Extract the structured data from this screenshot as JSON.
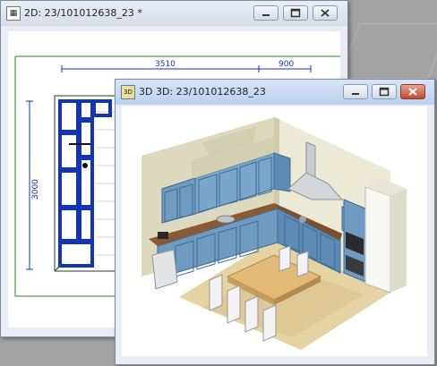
{
  "windows": {
    "win2d": {
      "title": "2D: 23/101012638_23 *",
      "dimensions": {
        "top_left": "3510",
        "top_right": "900",
        "side": "3000"
      }
    },
    "win3d": {
      "title": "3D 3D: 23/101012638_23",
      "icon": "3D"
    }
  },
  "controls": {
    "minimize": "minimize-icon",
    "maximize": "maximize-icon",
    "close": "close-icon"
  },
  "colors": {
    "drawing_blue": "#1234b8",
    "frame_green": "#2e7d2e",
    "titlebar_active": "#bcd1ee",
    "close_red": "#c44a2e"
  }
}
